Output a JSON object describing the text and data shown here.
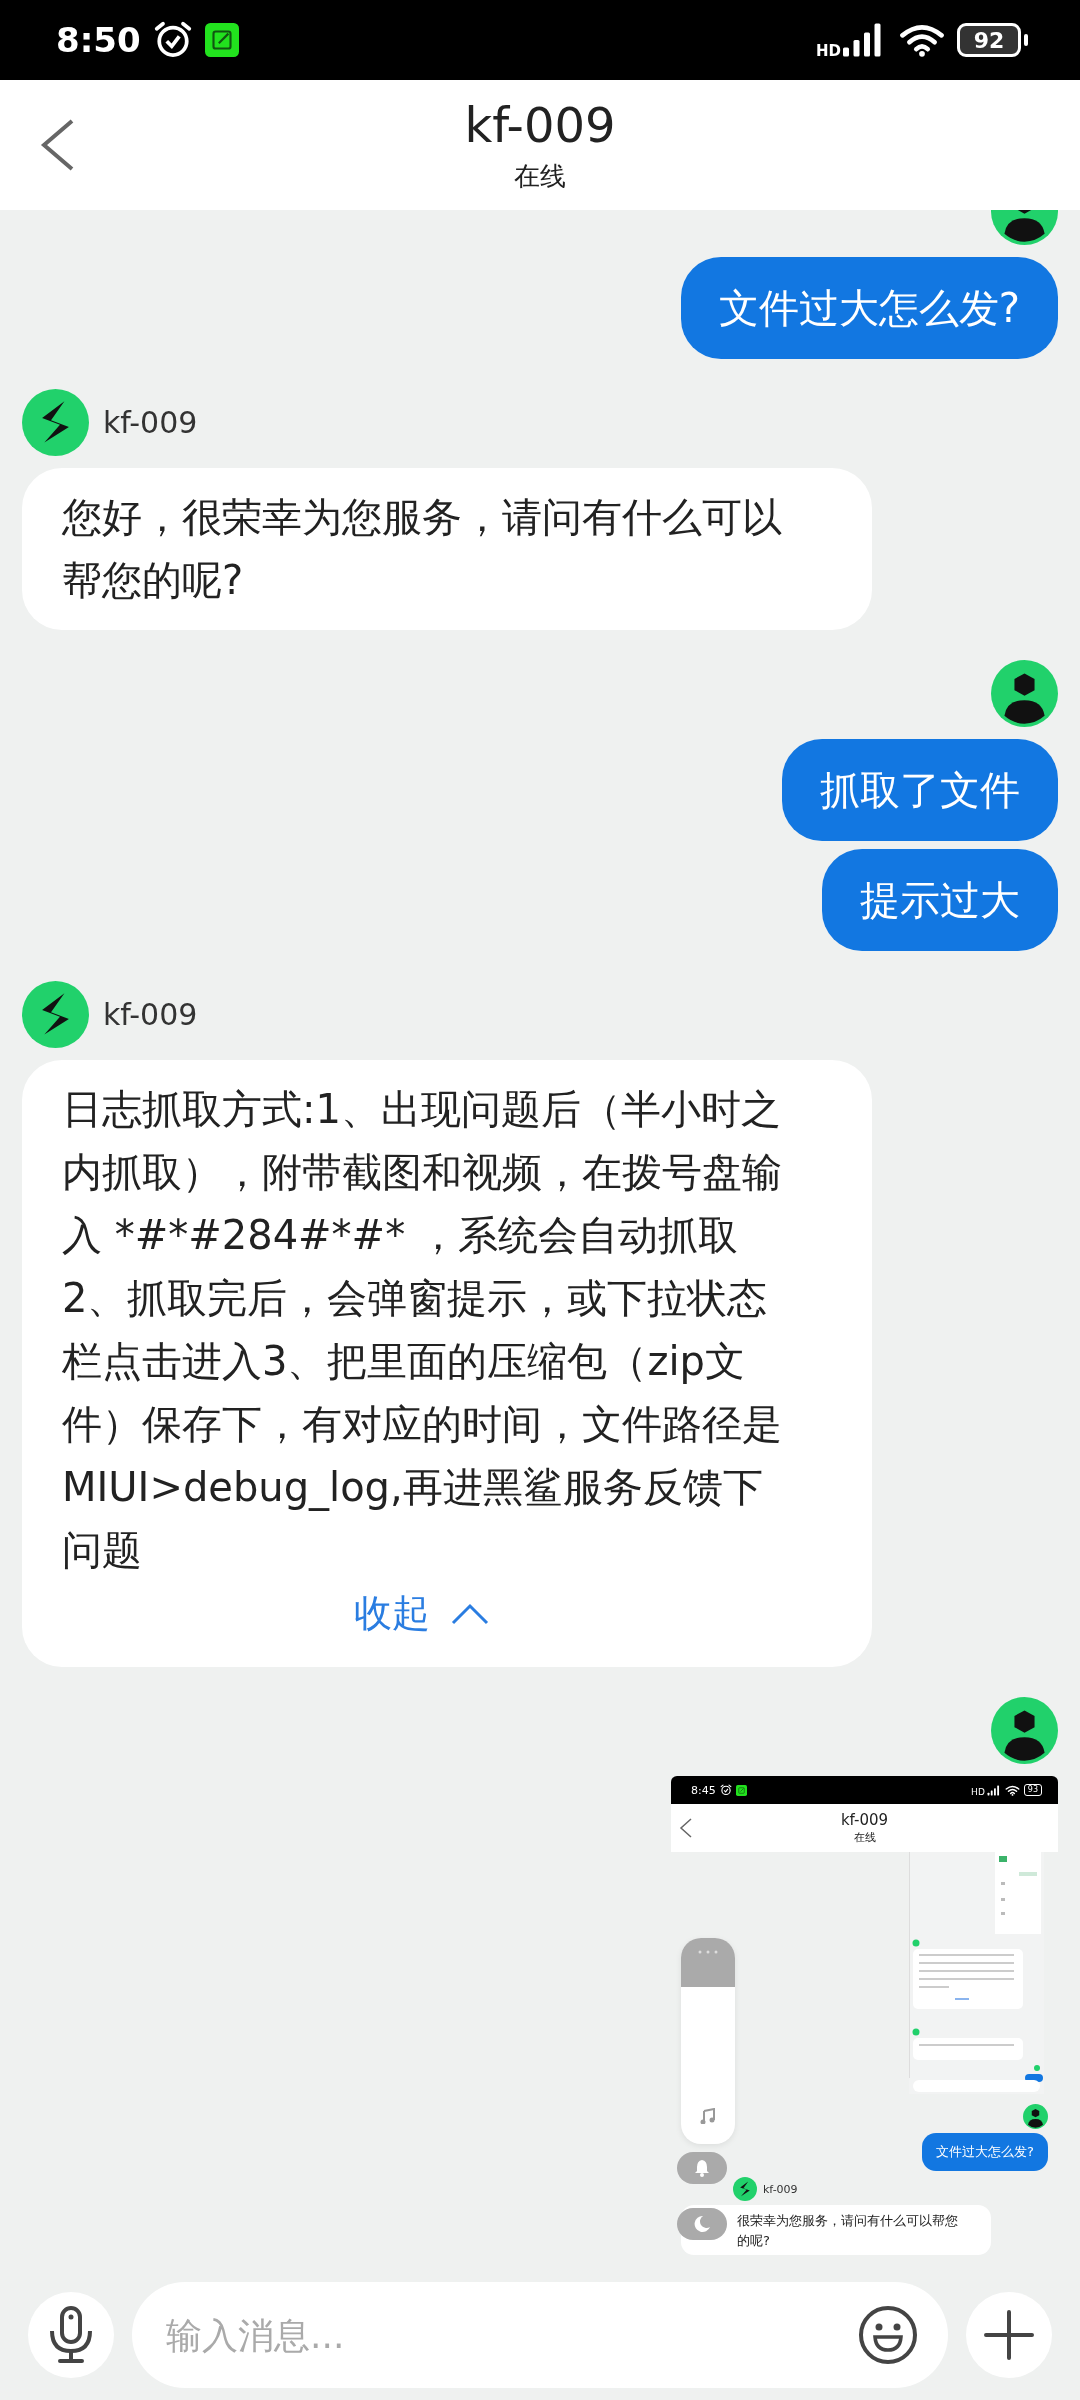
{
  "status_bar": {
    "time": "8:50",
    "network": "HD",
    "battery": "92"
  },
  "header": {
    "title": "kf-009",
    "subtitle": "在线"
  },
  "groups": [
    {
      "kind": "outgoing",
      "messages": [
        {
          "kind": "text",
          "text": "文件过大怎么发?"
        }
      ]
    },
    {
      "kind": "incoming",
      "name": "kf-009",
      "messages": [
        {
          "kind": "text",
          "text": "您好，很荣幸为您服务，请问有什么可以帮您的呢?"
        }
      ]
    },
    {
      "kind": "outgoing",
      "messages": [
        {
          "kind": "text",
          "text": "抓取了文件"
        },
        {
          "kind": "text",
          "text": "提示过大"
        }
      ]
    },
    {
      "kind": "incoming",
      "name": "kf-009",
      "messages": [
        {
          "kind": "text",
          "text": "日志抓取方式:1、出现问题后（半小时之内抓取），附带截图和视频，在拨号盘输入 *#*#284#*#* ，系统会自动抓取2、抓取完后，会弹窗提示，或下拉状态栏点击进入3、把里面的压缩包（zip文件）保存下，有对应的时间，文件路径是MIUI>debug_log,再进黑鲨服务反馈下问题",
          "toggle": {
            "label": "收起",
            "expanded": true
          }
        }
      ]
    },
    {
      "kind": "outgoing",
      "messages": [
        {
          "kind": "screenshot",
          "screenshot": {
            "status_bar": {
              "time": "8:45",
              "network": "HD",
              "battery": "93"
            },
            "header": {
              "title": "kf-009",
              "subtitle": "在线"
            },
            "user_message": "文件过大怎么发?",
            "agent_name": "kf-009",
            "agent_message": "很荣幸为您服务，请问有什么可以帮您的呢?"
          }
        }
      ]
    }
  ],
  "composer": {
    "placeholder": "输入消息..."
  }
}
